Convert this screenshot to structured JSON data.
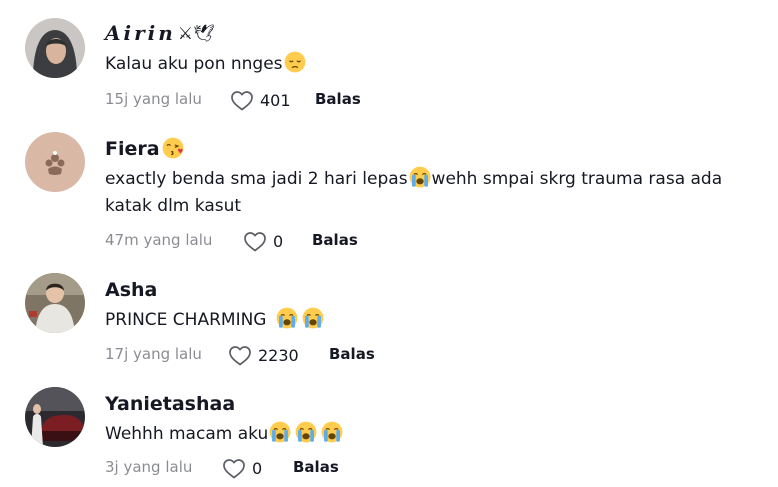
{
  "comments": [
    {
      "username": "𝑨𝒊𝒓𝒊𝒏",
      "username_deco": "⚔🕊",
      "text_parts": [
        "Kalau aku pon nnges"
      ],
      "emojis": [
        "pensive-face"
      ],
      "time": "15j yang lalu",
      "likes": "401",
      "reply_label": "Balas"
    },
    {
      "username": "Fiera",
      "username_emoji": "face-blowing-kiss",
      "text_before": "exactly benda sma jadi 2 hari lepas",
      "text_after": "wehh smpai skrg trauma rasa ada katak dlm kasut",
      "emojis": [
        "loudly-crying-face"
      ],
      "time": "47m yang lalu",
      "likes": "0",
      "reply_label": "Balas"
    },
    {
      "username": "Asha",
      "text": "PRINCE CHARMING",
      "emojis": [
        "loudly-crying-face",
        "loudly-crying-face"
      ],
      "time": "17j yang lalu",
      "likes": "2230",
      "reply_label": "Balas"
    },
    {
      "username": "Yanietashaa",
      "text": "Wehhh macam aku",
      "emojis": [
        "loudly-crying-face",
        "loudly-crying-face",
        "loudly-crying-face"
      ],
      "time": "3j yang lalu",
      "likes": "0",
      "reply_label": "Balas"
    }
  ],
  "colors": {
    "text": "#161823",
    "muted": "#8a8b91",
    "emoji_yellow": "#ffcc4d",
    "tear_blue": "#5dadec"
  }
}
